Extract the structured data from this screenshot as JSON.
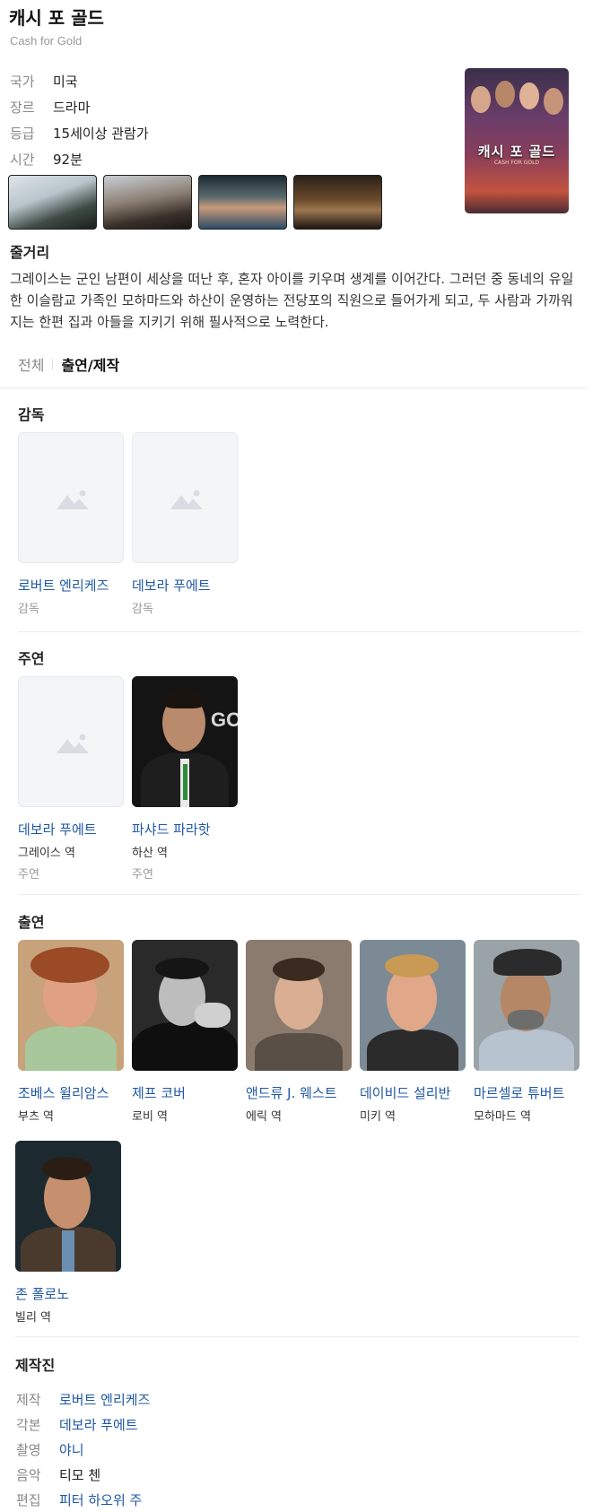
{
  "title": "캐시 포 골드",
  "original_title": "Cash for Gold",
  "info": [
    {
      "key": "국가",
      "value": "미국"
    },
    {
      "key": "장르",
      "value": "드라마"
    },
    {
      "key": "등급",
      "value": "15세이상 관람가"
    },
    {
      "key": "시간",
      "value": "92분"
    }
  ],
  "poster": {
    "title": "캐시 포 골드",
    "subtitle": "CASH FOR GOLD"
  },
  "synopsis": {
    "label": "줄거리",
    "text": "그레이스는 군인 남편이 세상을 떠난 후, 혼자 아이를 키우며 생계를 이어간다. 그러던 중 동네의 유일한 이슬람교 가족인 모하마드와 하산이 운영하는 전당포의 직원으로 들어가게 되고, 두 사람과 가까워지는 한편 집과 아들을 지키기 위해 필사적으로 노력한다."
  },
  "tabs": [
    {
      "label": "전체",
      "active": false
    },
    {
      "label": "출연/제작",
      "active": true
    }
  ],
  "directors": {
    "label": "감독",
    "people": [
      {
        "name": "로버트 엔리케즈",
        "sub": "감독"
      },
      {
        "name": "데보라 푸에트",
        "sub": "감독"
      }
    ]
  },
  "leads": {
    "label": "주연",
    "people": [
      {
        "name": "데보라 푸에트",
        "role": "그레이스 역",
        "sub": "주연"
      },
      {
        "name": "파샤드 파라핫",
        "role": "하산 역",
        "sub": "주연"
      }
    ]
  },
  "cast": {
    "label": "출연",
    "people": [
      {
        "name": "조베스 윌리암스",
        "role": "부츠 역"
      },
      {
        "name": "제프 코버",
        "role": "로비 역"
      },
      {
        "name": "앤드류 J. 웨스트",
        "role": "에릭 역"
      },
      {
        "name": "데이비드 설리반",
        "role": "미키 역"
      },
      {
        "name": "마르셀로 튜버트",
        "role": "모하마드 역"
      },
      {
        "name": "존 폴로노",
        "role": "빌리 역"
      }
    ]
  },
  "crew": {
    "label": "제작진",
    "rows": [
      {
        "key": "제작",
        "value": "로버트 엔리케즈"
      },
      {
        "key": "각본",
        "value": "데보라 푸에트"
      },
      {
        "key": "촬영",
        "value": "야니"
      },
      {
        "key": "음악",
        "value": "티모 첸"
      },
      {
        "key": "편집",
        "value": "피터 하오위 주"
      }
    ]
  }
}
